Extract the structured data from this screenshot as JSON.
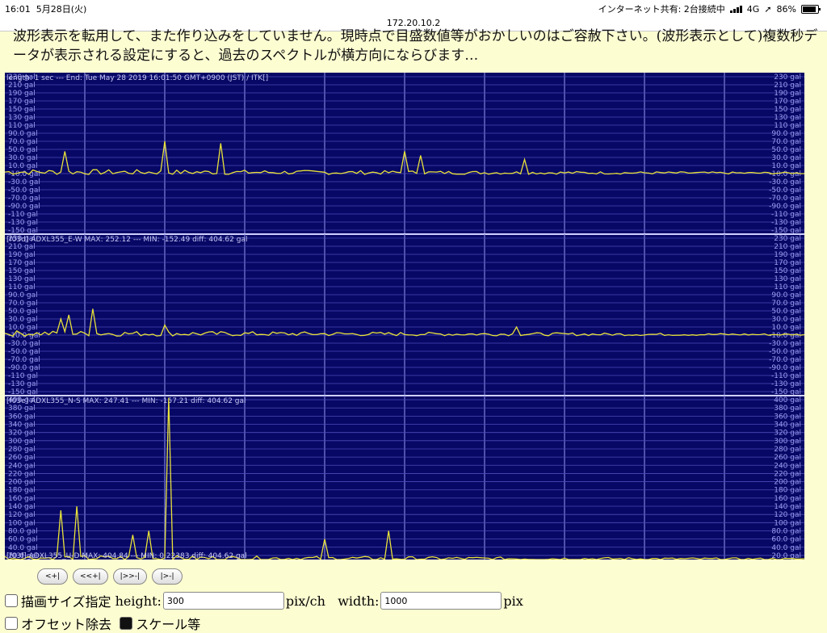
{
  "status": {
    "time": "16:01",
    "date": "5月28日(火)",
    "hotspot": "インターネット共有: 2台接続中",
    "network": "4G",
    "battery": "86%"
  },
  "url": "172.20.10.2",
  "intro": [
    "波形表示を転用して、また作り込みをしていません。現時点で目盛数値等がおかしいのはご容赦下さい。(波形表示として)複数秒デ",
    "ータが表示される設定にすると、過去のスペクトルが横方向にならびます…"
  ],
  "chart_data": [
    {
      "type": "line",
      "header": "length: 1 sec --- End: Tue May 28 2019 16:01:50 GMT+0900 (JST) / ITK[]",
      "yticks": [
        "230 gal",
        "210 gal",
        "190 gal",
        "170 gal",
        "150 gal",
        "130 gal",
        "110 gal",
        "90.0 gal",
        "70.0 gal",
        "50.0 gal",
        "30.0 gal",
        "10.0 gal",
        "-10.0 gal",
        "-30.0 gal",
        "-50.0 gal",
        "-70.0 gal",
        "-90.0 gal",
        "-110 gal",
        "-130 gal",
        "-150 gal"
      ],
      "ylim": [
        -150,
        250
      ],
      "peaks": [
        [
          0.075,
          55
        ],
        [
          0.2,
          80
        ],
        [
          0.27,
          75
        ],
        [
          0.5,
          55
        ],
        [
          0.52,
          45
        ],
        [
          0.65,
          35
        ]
      ]
    },
    {
      "type": "line",
      "header": "[f03d] ADXL355_E-W MAX: 252.12 --- MIN: -152.49 diff: 404.62 gal",
      "yticks": [
        "230 gal",
        "210 gal",
        "190 gal",
        "170 gal",
        "150 gal",
        "130 gal",
        "110 gal",
        "90.0 gal",
        "70.0 gal",
        "50.0 gal",
        "30.0 gal",
        "10.0 gal",
        "-10.0 gal",
        "-30.0 gal",
        "-50.0 gal",
        "-70.0 gal",
        "-90.0 gal",
        "-110 gal",
        "-130 gal",
        "-150 gal"
      ],
      "ylim": [
        -150,
        250
      ],
      "peaks": [
        [
          0.07,
          40
        ],
        [
          0.08,
          50
        ],
        [
          0.11,
          65
        ],
        [
          0.2,
          25
        ],
        [
          0.64,
          20
        ]
      ]
    },
    {
      "type": "line",
      "header": "[f03e] ADXL355_N-S MAX: 247.41 --- MIN: -157.21 diff: 404.62 gal",
      "yticks": [
        "400 gal",
        "380 gal",
        "360 gal",
        "340 gal",
        "320 gal",
        "300 gal",
        "280 gal",
        "260 gal",
        "240 gal",
        "220 gal",
        "200 gal",
        "180 gal",
        "160 gal",
        "140 gal",
        "120 gal",
        "100 gal",
        "80.0 gal",
        "60.0 gal",
        "40.0 gal",
        "20.0 gal"
      ],
      "ylim": [
        0,
        400
      ],
      "footer": "[f03f] ADXL355_U-D MAX: 404.84 --- MIN: 0.22383 diff: 404.62 gal",
      "peaks": [
        [
          0.07,
          120
        ],
        [
          0.09,
          130
        ],
        [
          0.16,
          60
        ],
        [
          0.18,
          70
        ],
        [
          0.205,
          395
        ],
        [
          0.4,
          50
        ],
        [
          0.48,
          70
        ]
      ]
    }
  ],
  "nav": [
    "<+|",
    "<<+|",
    "|>>-|",
    "|>-|"
  ],
  "controls": {
    "size_label": "描画サイズ指定",
    "height_label": "height:",
    "height_value": "300",
    "unit1": "pix/ch",
    "width_label": "width:",
    "width_value": "1000",
    "unit2": "pix",
    "row2a": "オフセット除去",
    "row2b": "スケール等"
  }
}
